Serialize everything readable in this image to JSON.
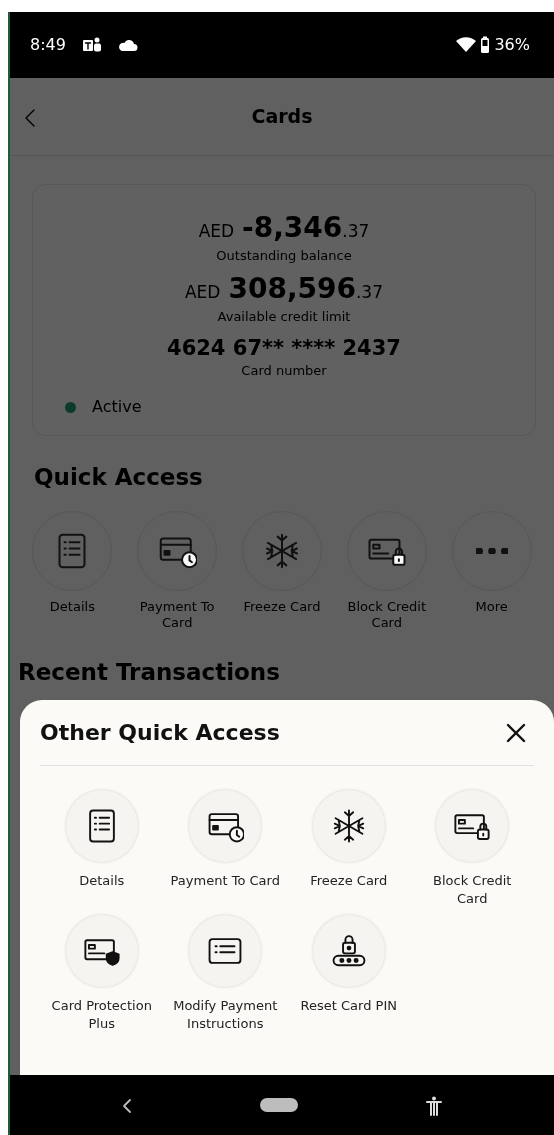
{
  "status_bar": {
    "time": "8:49",
    "battery": "36%"
  },
  "header": {
    "title": "Cards"
  },
  "card": {
    "amounts": [
      {
        "currency": "AED",
        "whole": "-8,346",
        "decimals": ".37",
        "caption": "Outstanding balance"
      },
      {
        "currency": "AED",
        "whole": "308,596",
        "decimals": ".37",
        "caption": "Available credit limit"
      }
    ],
    "card_number": "4624 67** **** 2437",
    "card_number_caption": "Card number",
    "status": {
      "label": "Active",
      "color": "#0b3b2a"
    }
  },
  "quick_access": {
    "title": "Quick Access",
    "items": [
      {
        "kind": "details",
        "label": "Details"
      },
      {
        "kind": "payment",
        "label": "Payment To Card"
      },
      {
        "kind": "freeze",
        "label": "Freeze Card"
      },
      {
        "kind": "block",
        "label": "Block Credit Card"
      },
      {
        "kind": "more",
        "label": "More"
      }
    ]
  },
  "recent_transactions": {
    "title": "Recent Transactions"
  },
  "sheet": {
    "title": "Other Quick Access",
    "items": [
      {
        "kind": "details",
        "label": "Details"
      },
      {
        "kind": "payment",
        "label": "Payment To Card"
      },
      {
        "kind": "freeze",
        "label": "Freeze Card"
      },
      {
        "kind": "block",
        "label": "Block Credit Card"
      },
      {
        "kind": "protection",
        "label": "Card Protection Plus"
      },
      {
        "kind": "modify",
        "label": "Modify Payment Instructions"
      },
      {
        "kind": "pin",
        "label": "Reset Card PIN"
      }
    ]
  }
}
